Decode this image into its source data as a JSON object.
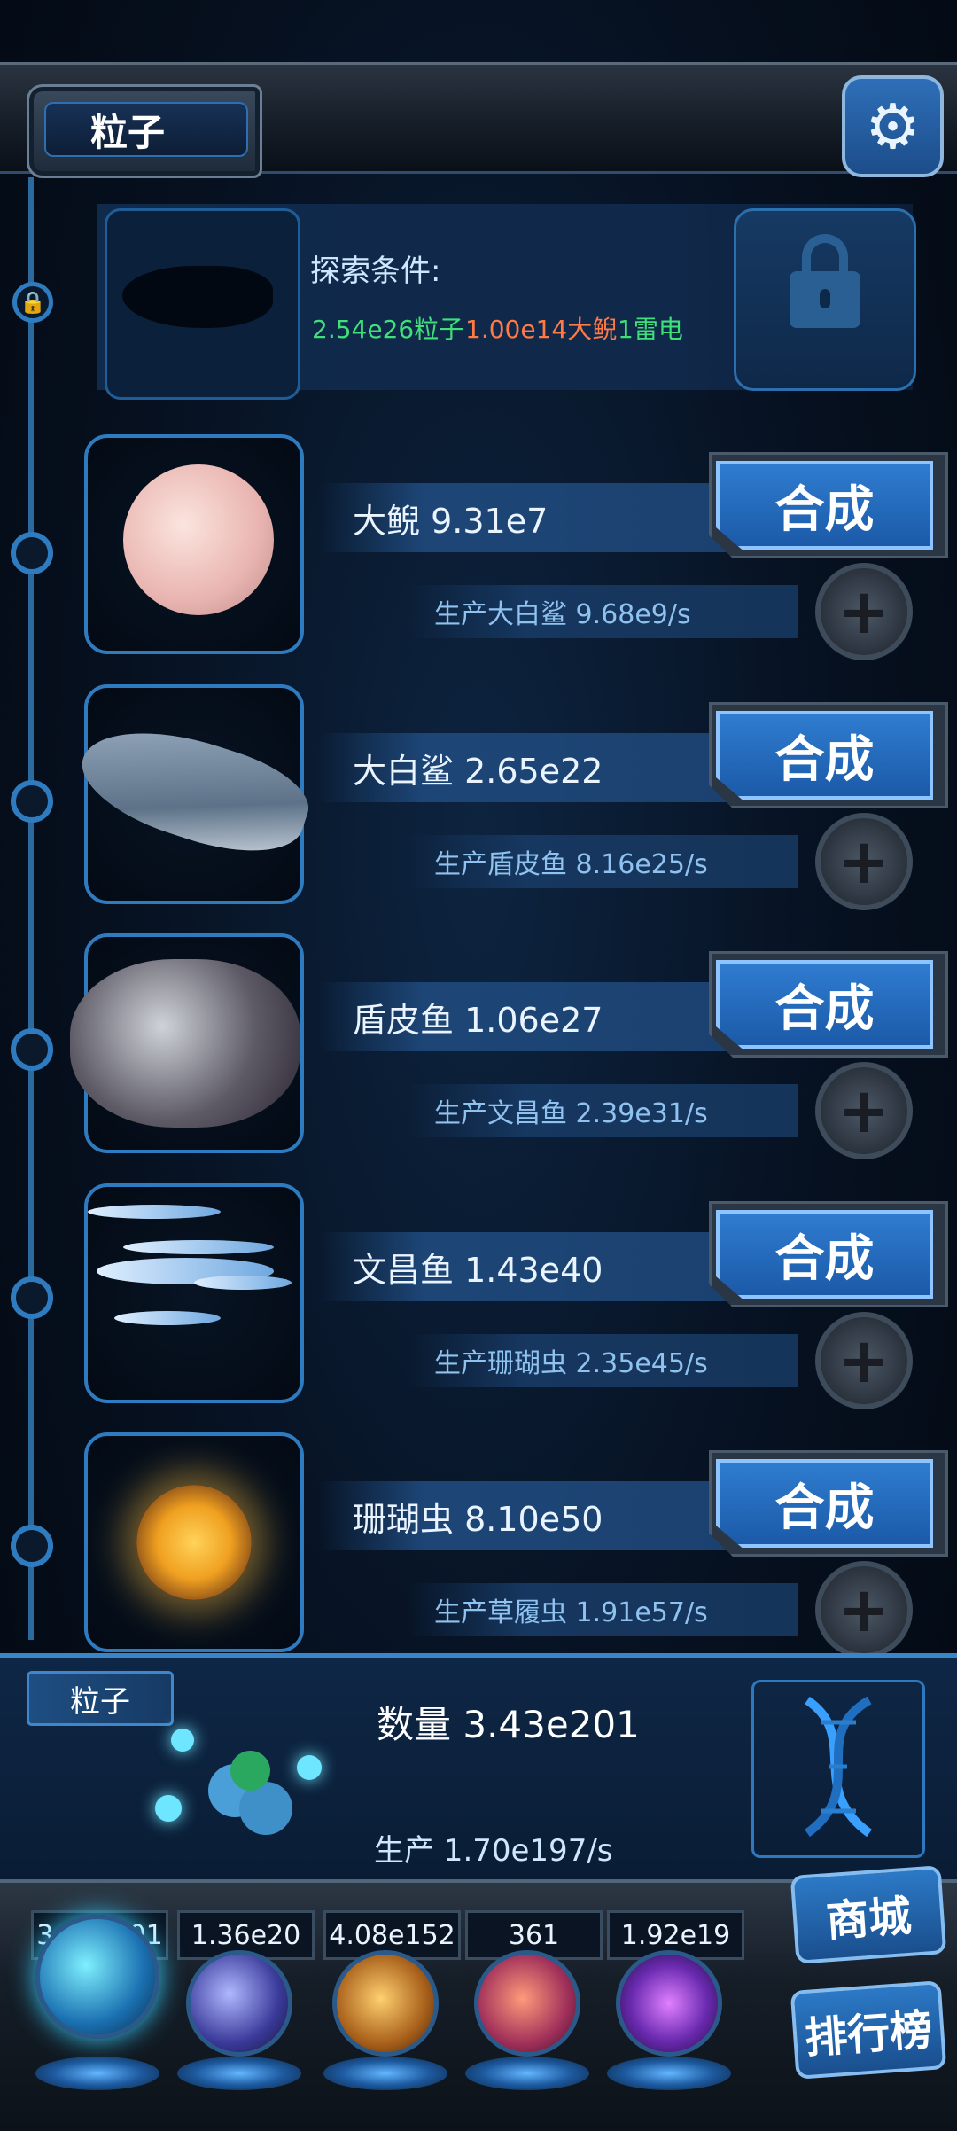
{
  "header": {
    "title": "粒子",
    "settings_icon": "gear-icon"
  },
  "explore": {
    "label": "探索条件:",
    "conditions": [
      {
        "text": "2.54e26粒子",
        "color": "#3fe07a"
      },
      {
        "text": "1.00e14大鲵",
        "color": "#ff7a45"
      },
      {
        "text": "1雷电",
        "color": "#3fe07a"
      }
    ],
    "lock_icon": "lock-icon"
  },
  "creatures": [
    {
      "name_line": "大鲵 9.31e7",
      "prod_line": "生产大白鲨 9.68e9/s",
      "merge_label": "合成",
      "art": "axolotl"
    },
    {
      "name_line": "大白鲨 2.65e22",
      "prod_line": "生产盾皮鱼 8.16e25/s",
      "merge_label": "合成",
      "art": "shark"
    },
    {
      "name_line": "盾皮鱼 1.06e27",
      "prod_line": "生产文昌鱼 2.39e31/s",
      "merge_label": "合成",
      "art": "placoderm"
    },
    {
      "name_line": "文昌鱼 1.43e40",
      "prod_line": "生产珊瑚虫 2.35e45/s",
      "merge_label": "合成",
      "art": "lancelet"
    },
    {
      "name_line": "珊瑚虫 8.10e50",
      "prod_line": "生产草履虫 1.91e57/s",
      "merge_label": "合成",
      "art": "coral-polyp"
    }
  ],
  "resource": {
    "tab": "粒子",
    "quantity": "数量 3.43e201",
    "production": "生产 1.70e197/s"
  },
  "dock": {
    "stats": [
      "3.43e201",
      "1.36e20",
      "4.08e152",
      "361",
      "1.92e19"
    ],
    "orbs": [
      "particle-orb",
      "lightning-orb",
      "nebula-orb",
      "brain-orb",
      "vortex-orb"
    ],
    "shop_label": "商城",
    "rank_label": "排行榜"
  }
}
